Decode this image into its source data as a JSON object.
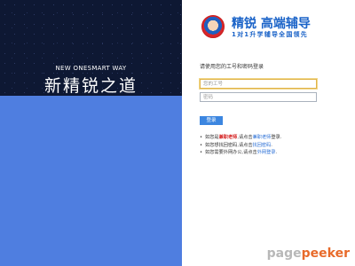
{
  "left": {
    "tagline_en": "NEW ONESMART WAY",
    "tagline_cn": "新精锐之道"
  },
  "brand": {
    "title": "精锐 高端辅导",
    "subtitle": "1对1升学辅导全国领先",
    "logo_icon": "onesmart-logo-badge"
  },
  "login": {
    "prompt": "请使用您的工号和密码登录",
    "id_placeholder": "您的工号",
    "password_placeholder": "密码",
    "submit_label": "登录"
  },
  "tips": [
    {
      "pre": "如您是",
      "em": "兼职老师",
      "mid": ",请点击",
      "link": "兼职老师",
      "post": "登录."
    },
    {
      "pre": "如您想找回密码,请点击",
      "link": "找回密码",
      "post": "."
    },
    {
      "pre": "如您需要外网办公,请点击",
      "link": "外网登录",
      "post": "."
    }
  ],
  "watermark": {
    "part1": "page",
    "part2": "peeker"
  },
  "colors": {
    "left_dark": "#0e1833",
    "left_blue": "#4f7ee0",
    "brand_blue": "#1a63c8",
    "button": "#3c86e0",
    "highlight_red": "#d42020"
  }
}
